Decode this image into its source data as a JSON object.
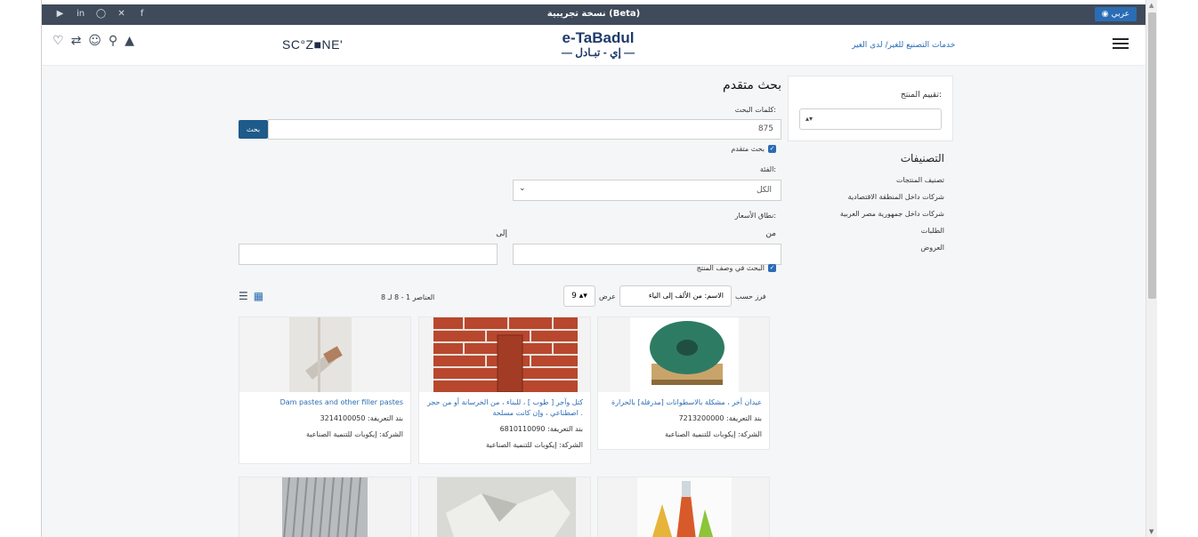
{
  "topbar": {
    "beta_text": "نسخة تجريبية (Beta)",
    "lang_label": "عربي",
    "social_icons": [
      "youtube-icon",
      "linkedin-icon",
      "instagram-icon",
      "x-icon",
      "facebook-icon"
    ]
  },
  "header": {
    "sczone": "SC°Z■NE'",
    "logo_en": "e-TaBadul",
    "logo_ar": "— إي - تبـادل —",
    "services_link": "خدمات التصنيع للغير/ لدى الغير",
    "icons": [
      "wishlist-icon",
      "compare-icon",
      "account-icon",
      "search-icon",
      "logo-small-icon"
    ]
  },
  "main": {
    "title": "بحث متقدم",
    "keywords_label": "كلمات البحث:",
    "keywords_value": "875",
    "search_button": "بحث",
    "advanced_checkbox": "بحث متقدم",
    "category_label": "الفئة:",
    "category_value": "الكل",
    "price_range_label": "نطاق الأسعار:",
    "from_label": "من",
    "to_label": "إلى",
    "desc_checkbox": "البحث في وصف المنتج"
  },
  "toolbar": {
    "sort_label": "فرز حسب",
    "sort_value": "الاسم: من الألف إلى الياء",
    "show_label": "عرض",
    "show_value": "9",
    "count_text": "العناصر 1 - 8 لـ 8"
  },
  "sidebar": {
    "rating_label": "تقييم المنتج:",
    "categories_title": "التصنيفات",
    "items": [
      "تصنيف المنتجات",
      "شركات داخل المنطقة الاقتصادية",
      "شركات داخل جمهورية مصر العربية",
      "الطلبات",
      "العروض"
    ]
  },
  "products": [
    {
      "name": "عيدان أخر ، مشكلة بالاسطوانات [مدرفلة] بالحرارة",
      "tariff": "بند التعريفة: 7213200000",
      "company": "الشركة: إيكوبات للتنمية الصناعية"
    },
    {
      "name": "كتل وآجر [ طوب ] ، للبناء ، من الخرسانة أو من حجر اصطناعي ، وإن كانت مسلحة .",
      "tariff": "بند التعريفة: 6810110090",
      "company": "الشركة: إيكوبات للتنمية الصناعية"
    },
    {
      "name": "Dam pastes and other filler pastes",
      "tariff": "بند التعريفة: 3214100050",
      "company": "الشركة: إيكوبات للتنمية الصناعية"
    }
  ]
}
